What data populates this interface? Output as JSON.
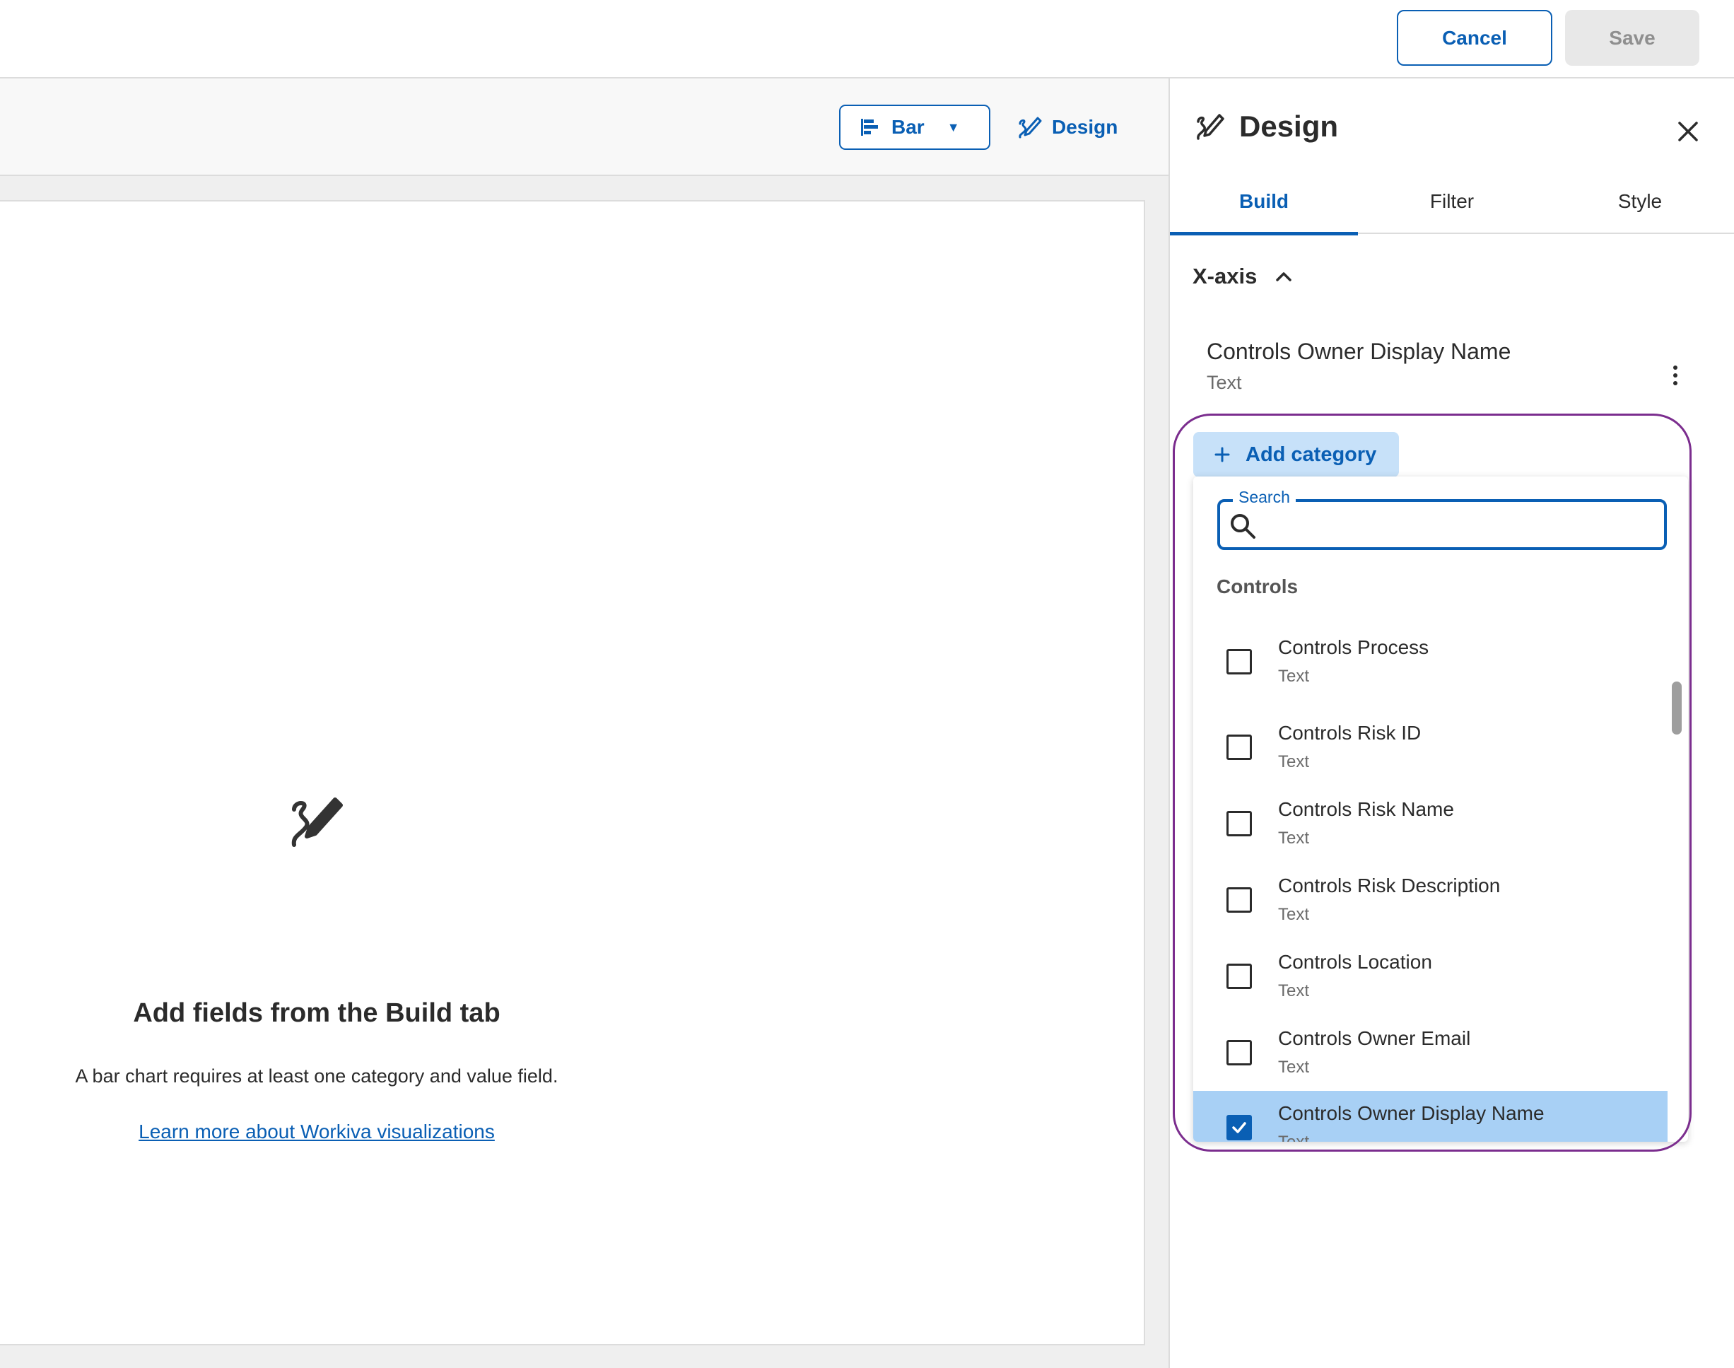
{
  "topbar": {
    "cancel_label": "Cancel",
    "save_label": "Save"
  },
  "toolbar": {
    "chart_type_label": "Bar",
    "design_label": "Design"
  },
  "empty_state": {
    "title": "Add fields from the Build tab",
    "description": "A bar chart requires at least one category and value field.",
    "link_text": "Learn more about Workiva visualizations"
  },
  "panel": {
    "title": "Design",
    "tabs": [
      {
        "label": "Build",
        "active": true
      },
      {
        "label": "Filter",
        "active": false
      },
      {
        "label": "Style",
        "active": false
      }
    ],
    "xaxis": {
      "label": "X-axis",
      "field": {
        "name": "Controls Owner Display Name",
        "type": "Text"
      }
    },
    "add_category_label": "Add category",
    "search": {
      "legend": "Search",
      "value": ""
    },
    "group_label": "Controls",
    "options": [
      {
        "name": "Controls Process",
        "type": "Text",
        "checked": false
      },
      {
        "name": "Controls Risk ID",
        "type": "Text",
        "checked": false
      },
      {
        "name": "Controls Risk Name",
        "type": "Text",
        "checked": false
      },
      {
        "name": "Controls Risk Description",
        "type": "Text",
        "checked": false
      },
      {
        "name": "Controls Location",
        "type": "Text",
        "checked": false
      },
      {
        "name": "Controls Owner Email",
        "type": "Text",
        "checked": false
      },
      {
        "name": "Controls Owner Display Name",
        "type": "Text",
        "checked": true
      }
    ]
  },
  "colors": {
    "accent": "#0a5fb4",
    "selected_row": "#a8d0f5",
    "add_category_bg": "#c7e1f9",
    "highlight_ring": "#7b2d8e"
  },
  "icons": {
    "bar_chart": "bar-chart-icon",
    "design": "design-pencil-icon",
    "close": "close-icon",
    "chevron_up": "chevron-up-icon",
    "kebab": "kebab-menu-icon",
    "plus": "plus-icon",
    "search": "search-icon",
    "checkmark": "checkmark-icon"
  }
}
